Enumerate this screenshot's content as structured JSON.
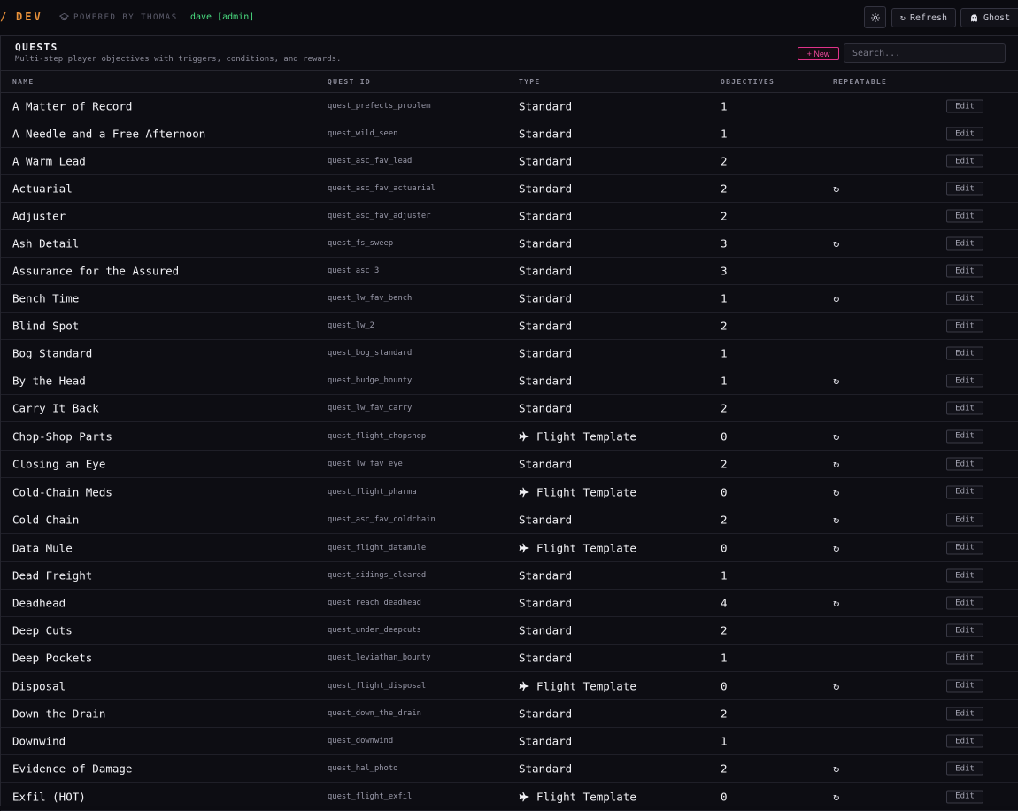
{
  "topbar": {
    "brand_mark": "/",
    "brand": "DEV",
    "powered": "POWERED BY THOMAS",
    "user": "dave [admin]",
    "refresh_label": "Refresh",
    "ghost_label": "Ghost"
  },
  "panel": {
    "title": "QUESTS",
    "subtitle": "Multi-step player objectives with triggers, conditions, and rewards.",
    "new_label": "+ New",
    "search_placeholder": "Search..."
  },
  "columns": {
    "name": "NAME",
    "quest_id": "QUEST ID",
    "type": "TYPE",
    "objectives": "OBJECTIVES",
    "repeatable": "REPEATABLE"
  },
  "edit_label": "Edit",
  "repeat_glyph": "↻",
  "quests": [
    {
      "name": "A Matter of Record",
      "id": "quest_prefects_problem",
      "type": "Standard",
      "flight": false,
      "objectives": "1",
      "repeatable": false
    },
    {
      "name": "A Needle and a Free Afternoon",
      "id": "quest_wild_seen",
      "type": "Standard",
      "flight": false,
      "objectives": "1",
      "repeatable": false
    },
    {
      "name": "A Warm Lead",
      "id": "quest_asc_fav_lead",
      "type": "Standard",
      "flight": false,
      "objectives": "2",
      "repeatable": false
    },
    {
      "name": "Actuarial",
      "id": "quest_asc_fav_actuarial",
      "type": "Standard",
      "flight": false,
      "objectives": "2",
      "repeatable": true
    },
    {
      "name": "Adjuster",
      "id": "quest_asc_fav_adjuster",
      "type": "Standard",
      "flight": false,
      "objectives": "2",
      "repeatable": false
    },
    {
      "name": "Ash Detail",
      "id": "quest_fs_sweep",
      "type": "Standard",
      "flight": false,
      "objectives": "3",
      "repeatable": true
    },
    {
      "name": "Assurance for the Assured",
      "id": "quest_asc_3",
      "type": "Standard",
      "flight": false,
      "objectives": "3",
      "repeatable": false
    },
    {
      "name": "Bench Time",
      "id": "quest_lw_fav_bench",
      "type": "Standard",
      "flight": false,
      "objectives": "1",
      "repeatable": true
    },
    {
      "name": "Blind Spot",
      "id": "quest_lw_2",
      "type": "Standard",
      "flight": false,
      "objectives": "2",
      "repeatable": false
    },
    {
      "name": "Bog Standard",
      "id": "quest_bog_standard",
      "type": "Standard",
      "flight": false,
      "objectives": "1",
      "repeatable": false
    },
    {
      "name": "By the Head",
      "id": "quest_budge_bounty",
      "type": "Standard",
      "flight": false,
      "objectives": "1",
      "repeatable": true
    },
    {
      "name": "Carry It Back",
      "id": "quest_lw_fav_carry",
      "type": "Standard",
      "flight": false,
      "objectives": "2",
      "repeatable": false
    },
    {
      "name": "Chop-Shop Parts",
      "id": "quest_flight_chopshop",
      "type": "Flight Template",
      "flight": true,
      "objectives": "0",
      "repeatable": true
    },
    {
      "name": "Closing an Eye",
      "id": "quest_lw_fav_eye",
      "type": "Standard",
      "flight": false,
      "objectives": "2",
      "repeatable": true
    },
    {
      "name": "Cold-Chain Meds",
      "id": "quest_flight_pharma",
      "type": "Flight Template",
      "flight": true,
      "objectives": "0",
      "repeatable": true
    },
    {
      "name": "Cold Chain",
      "id": "quest_asc_fav_coldchain",
      "type": "Standard",
      "flight": false,
      "objectives": "2",
      "repeatable": true
    },
    {
      "name": "Data Mule",
      "id": "quest_flight_datamule",
      "type": "Flight Template",
      "flight": true,
      "objectives": "0",
      "repeatable": true
    },
    {
      "name": "Dead Freight",
      "id": "quest_sidings_cleared",
      "type": "Standard",
      "flight": false,
      "objectives": "1",
      "repeatable": false
    },
    {
      "name": "Deadhead",
      "id": "quest_reach_deadhead",
      "type": "Standard",
      "flight": false,
      "objectives": "4",
      "repeatable": true
    },
    {
      "name": "Deep Cuts",
      "id": "quest_under_deepcuts",
      "type": "Standard",
      "flight": false,
      "objectives": "2",
      "repeatable": false
    },
    {
      "name": "Deep Pockets",
      "id": "quest_leviathan_bounty",
      "type": "Standard",
      "flight": false,
      "objectives": "1",
      "repeatable": false
    },
    {
      "name": "Disposal",
      "id": "quest_flight_disposal",
      "type": "Flight Template",
      "flight": true,
      "objectives": "0",
      "repeatable": true
    },
    {
      "name": "Down the Drain",
      "id": "quest_down_the_drain",
      "type": "Standard",
      "flight": false,
      "objectives": "2",
      "repeatable": false
    },
    {
      "name": "Downwind",
      "id": "quest_downwind",
      "type": "Standard",
      "flight": false,
      "objectives": "1",
      "repeatable": false
    },
    {
      "name": "Evidence of Damage",
      "id": "quest_hal_photo",
      "type": "Standard",
      "flight": false,
      "objectives": "2",
      "repeatable": true
    },
    {
      "name": "Exfil (HOT)",
      "id": "quest_flight_exfil",
      "type": "Flight Template",
      "flight": true,
      "objectives": "0",
      "repeatable": true
    }
  ]
}
